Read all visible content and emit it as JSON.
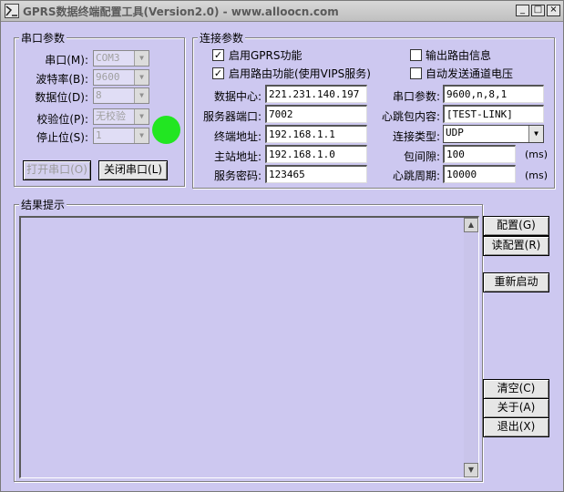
{
  "window": {
    "title": "GPRS数据终端配置工具(Version2.0) - www.alloocn.com",
    "controls": {
      "minimize": "_",
      "maximize": "□",
      "close": "×"
    }
  },
  "serial_group": {
    "title": "串口参数",
    "port_label": "串口(M):",
    "port_value": "COM3",
    "baud_label": "波特率(B):",
    "baud_value": "9600",
    "databits_label": "数据位(D):",
    "databits_value": "8",
    "parity_label": "校验位(P):",
    "parity_value": "无校验",
    "stopbits_label": "停止位(S):",
    "stopbits_value": "1",
    "status_color": "#22e622",
    "open_button": "打开串口(O)",
    "close_button": "关闭串口(L)"
  },
  "connection_group": {
    "title": "连接参数",
    "enable_gprs_label": "启用GPRS功能",
    "enable_gprs_checked": "✓",
    "enable_routing_label": "启用路由功能(使用VIPS服务)",
    "enable_routing_checked": "✓",
    "output_route_label": "输出路由信息",
    "auto_send_label": "自动发送通道电压",
    "data_center_label": "数据中心:",
    "data_center_value": "221.231.140.197",
    "server_port_label": "服务器端口:",
    "server_port_value": "7002",
    "terminal_addr_label": "终端地址:",
    "terminal_addr_value": "192.168.1.1",
    "master_addr_label": "主站地址:",
    "master_addr_value": "192.168.1.0",
    "service_pwd_label": "服务密码:",
    "service_pwd_value": "123465",
    "serial_params_label": "串口参数:",
    "serial_params_value": "9600,n,8,1",
    "heartbeat_content_label": "心跳包内容:",
    "heartbeat_content_value": "[TEST-LINK]",
    "conn_type_label": "连接类型:",
    "conn_type_value": "UDP",
    "packet_gap_label": "包间隙:",
    "packet_gap_value": "100",
    "packet_gap_unit": "(ms)",
    "heartbeat_period_label": "心跳周期:",
    "heartbeat_period_value": "10000",
    "heartbeat_period_unit": "(ms)"
  },
  "result_group": {
    "title": "结果提示"
  },
  "side_buttons": {
    "configure": "配置(G)",
    "read_config": "读配置(R)",
    "restart": "重新启动",
    "clear": "清空(C)",
    "about": "关于(A)",
    "exit": "退出(X)"
  },
  "icons": {
    "app": "app-icon",
    "dropdown": "chevron-down-icon",
    "scroll_up": "scroll-up-icon",
    "scroll_down": "scroll-down-icon"
  }
}
